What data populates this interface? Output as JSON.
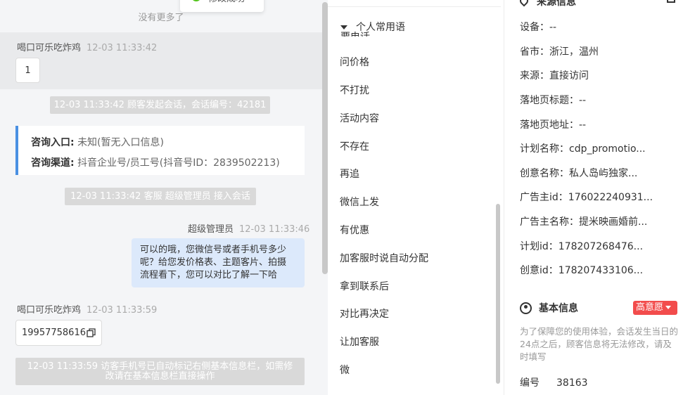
{
  "toast": {
    "text": "修改成功"
  },
  "chat": {
    "no_more": "没有更多了",
    "msg1": {
      "sender": "喝口可乐吃炸鸡",
      "time": "12-03 11:33:42",
      "content": "1"
    },
    "sys1": "12-03 11:33:42 顾客发起会话，会话编号：42181",
    "card": {
      "entry_label": "咨询入口:",
      "entry_value": "未知(暂无入口信息)",
      "channel_label": "咨询渠道:",
      "channel_value": "抖音企业号/员工号(抖音号ID：2839502213)"
    },
    "sys2": "12-03 11:33:42 客服 超级管理员 接入会话",
    "msg2": {
      "sender": "超级管理员",
      "time": "12-03 11:33:46",
      "lines": [
        "可以的哦，您微信号或者手机号多少",
        "呢？给您发价格表、主题客片、拍摄",
        "流程看下，您可以对比了解一下哈"
      ]
    },
    "msg3": {
      "sender": "喝口可乐吃炸鸡",
      "time": "12-03 11:33:59",
      "content": "19957758616"
    },
    "sys3_lines": [
      "12-03 11:33:59 访客手机号已自动标记右侧基本信息栏，如需修",
      "改请在基本信息栏直接操作"
    ]
  },
  "phrases": {
    "header": "个人常用语",
    "cut_item": "要电话",
    "items": [
      "问价格",
      "不打扰",
      "活动内容",
      "不存在",
      "再追",
      "微信上发",
      "有优惠",
      "加客服时说自动分配",
      "拿到联系后",
      "对比再决定",
      "让加客服",
      "微"
    ]
  },
  "info": {
    "source_title": "来源信息",
    "rows": [
      {
        "label": "设备：",
        "value": "--"
      },
      {
        "label": "省市：",
        "value": "浙江，温州"
      },
      {
        "label": "来源：",
        "value": "直接访问"
      },
      {
        "label": "落地页标题：",
        "value": "--"
      },
      {
        "label": "落地页地址：",
        "value": "--"
      },
      {
        "label": "计划名称：",
        "value": "cdp_promotio..."
      },
      {
        "label": "创意名称：",
        "value": "私人岛屿独家..."
      },
      {
        "label": "广告主id：",
        "value": "176022240931..."
      },
      {
        "label": "广告主名称：",
        "value": "提米映画婚前..."
      },
      {
        "label": "计划id：",
        "value": "178207268476..."
      },
      {
        "label": "创意id：",
        "value": "178207433106..."
      }
    ],
    "basic_title": "基本信息",
    "intent": "高意愿",
    "notice": "为了保障您的使用体验，会话发生当日的24点之后，顾客信息将无法修改，请及时填写",
    "id_label": "编号",
    "id_value": "38163"
  },
  "colors": {
    "accent": "#4a90e2",
    "badge": "#f24c4c",
    "my_bubble": "#dce9fb",
    "sysbar": "#d9d9d9"
  }
}
